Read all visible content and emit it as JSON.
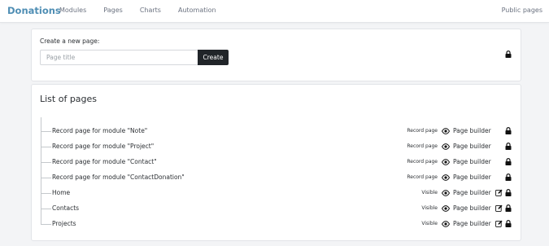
{
  "header": {
    "brand": "Donations",
    "nav": [
      "Modules",
      "Pages",
      "Charts",
      "Automation"
    ],
    "right_link": "Public pages"
  },
  "create": {
    "label": "Create a new page:",
    "placeholder": "Page title",
    "value": "",
    "button": "Create"
  },
  "list": {
    "title": "List of pages",
    "builder_label": "Page builder",
    "rows": [
      {
        "label": "Record page for module \"Note\"",
        "badge": "Record page",
        "editable": false
      },
      {
        "label": "Record page for module \"Project\"",
        "badge": "Record page",
        "editable": false
      },
      {
        "label": "Record page for module \"Contact\"",
        "badge": "Record page",
        "editable": false
      },
      {
        "label": "Record page for module \"ContactDonation\"",
        "badge": "Record page",
        "editable": false
      },
      {
        "label": "Home",
        "badge": "Visible",
        "editable": true
      },
      {
        "label": "Contacts",
        "badge": "Visible",
        "editable": true
      },
      {
        "label": "Projects",
        "badge": "Visible",
        "editable": true
      }
    ]
  },
  "colors": {
    "brand": "#4f8eb4",
    "button": "#212529",
    "background": "#f3f4f6"
  },
  "icons": {
    "lock": "lock-icon",
    "eye": "eye-icon",
    "edit": "edit-icon"
  }
}
